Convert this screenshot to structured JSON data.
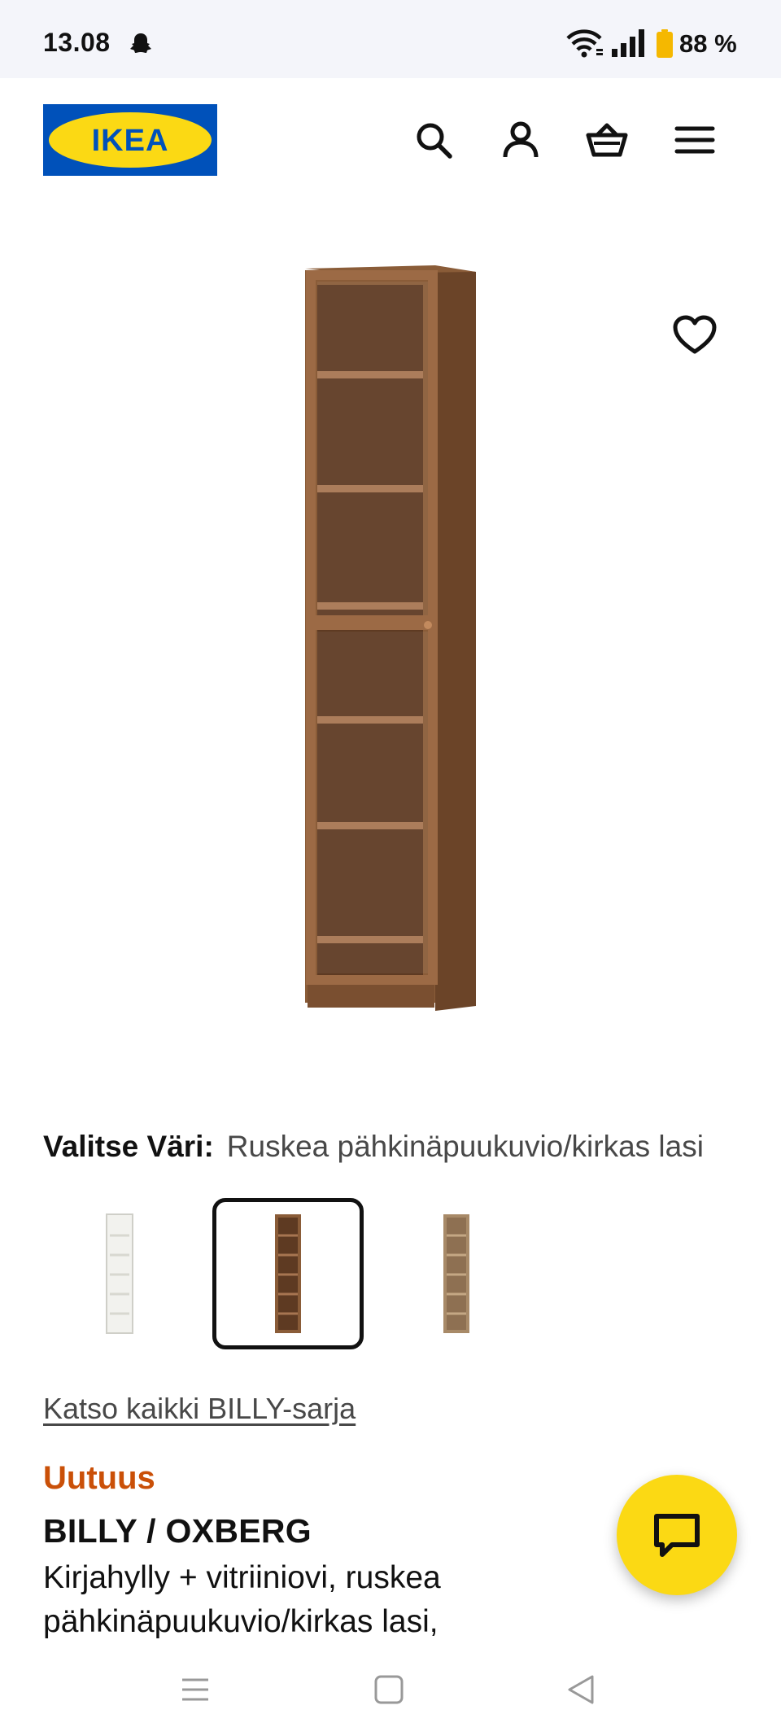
{
  "status_bar": {
    "time": "13.08",
    "battery_percent": "88 %",
    "battery_level": 0.88,
    "battery_color": "#f5b800"
  },
  "header": {
    "logo_text": "IKEA",
    "brand_blue": "#0051ba",
    "brand_yellow": "#fbd914",
    "icons": [
      "search-icon",
      "user-icon",
      "basket-icon",
      "menu-icon"
    ]
  },
  "product": {
    "color_label": "Valitse Väri:",
    "color_value": "Ruskea pähkinäpuukuvio/kirkas lasi",
    "swatches": [
      {
        "name": "white",
        "selected": false
      },
      {
        "name": "brown-walnut",
        "selected": true
      },
      {
        "name": "oak",
        "selected": false
      }
    ],
    "series_link": "Katso kaikki BILLY-sarja",
    "badge": "Uutuus",
    "badge_color": "#ca5008",
    "name": "BILLY / OXBERG",
    "description": "Kirjahylly + vitriiniovi, ruskea pähkinäpuukuvio/kirkas lasi,"
  },
  "chat": {
    "icon": "chat-icon",
    "color": "#fbd914"
  },
  "nav_bar": {
    "icons": [
      "recent-apps-icon",
      "home-icon",
      "back-icon"
    ]
  }
}
